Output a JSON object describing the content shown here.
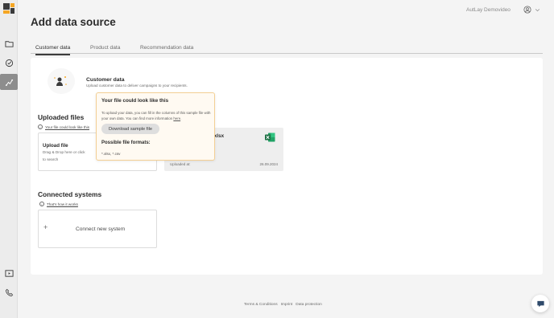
{
  "header": {
    "title": "Add data source",
    "user_name": "AutLay Demovideo",
    "account_icon": "account-circle-icon",
    "dropdown_icon": "chevron-down-icon"
  },
  "sidebar": {
    "logo": "autlay-logo",
    "items": [
      {
        "name": "folder",
        "icon": "folder-icon"
      },
      {
        "name": "campaign",
        "icon": "badge-icon"
      },
      {
        "name": "data-sources",
        "icon": "route-icon",
        "active": true
      },
      {
        "name": "video",
        "icon": "video-play-icon"
      },
      {
        "name": "support",
        "icon": "phone-icon"
      }
    ]
  },
  "tabs": [
    {
      "label": "Customer data",
      "active": true
    },
    {
      "label": "Product data",
      "active": false
    },
    {
      "label": "Recommendation data",
      "active": false
    }
  ],
  "customer_section": {
    "title": "Customer data",
    "description": "Upload customer data to deliver campaigns to your recipients."
  },
  "uploaded_files": {
    "title": "Uploaded files",
    "info_link": "Your file could look like this",
    "upload_box": {
      "title": "Upload file",
      "hint": "Drag & Drop here or click to search"
    },
    "file": {
      "name": "r.xlsx",
      "uploaded_label": "Uploaded at:",
      "uploaded_date": "26.09.2024"
    }
  },
  "connected_systems": {
    "title": "Connected systems",
    "info_link": "That's how it works",
    "connect_plus": "+",
    "connect_label": "Connect new system"
  },
  "tooltip": {
    "title": "Your file could look like this",
    "body_prefix": "To upload your data, you can fill in the columns of this sample file with your own data. You can find more information ",
    "body_link": "here",
    "body_suffix": ".",
    "button": "Download sample file",
    "formats_title": "Possible file formats:",
    "formats": "*.xlsx, *.csv"
  },
  "footer": {
    "links": [
      "Terms & Conditions",
      "Imprint",
      "Data protection"
    ]
  },
  "colors": {
    "brand_orange": "#f5a623",
    "brand_dark": "#3a3a3a",
    "excel_green": "#1e7145",
    "tooltip_border": "#f3cf94"
  }
}
